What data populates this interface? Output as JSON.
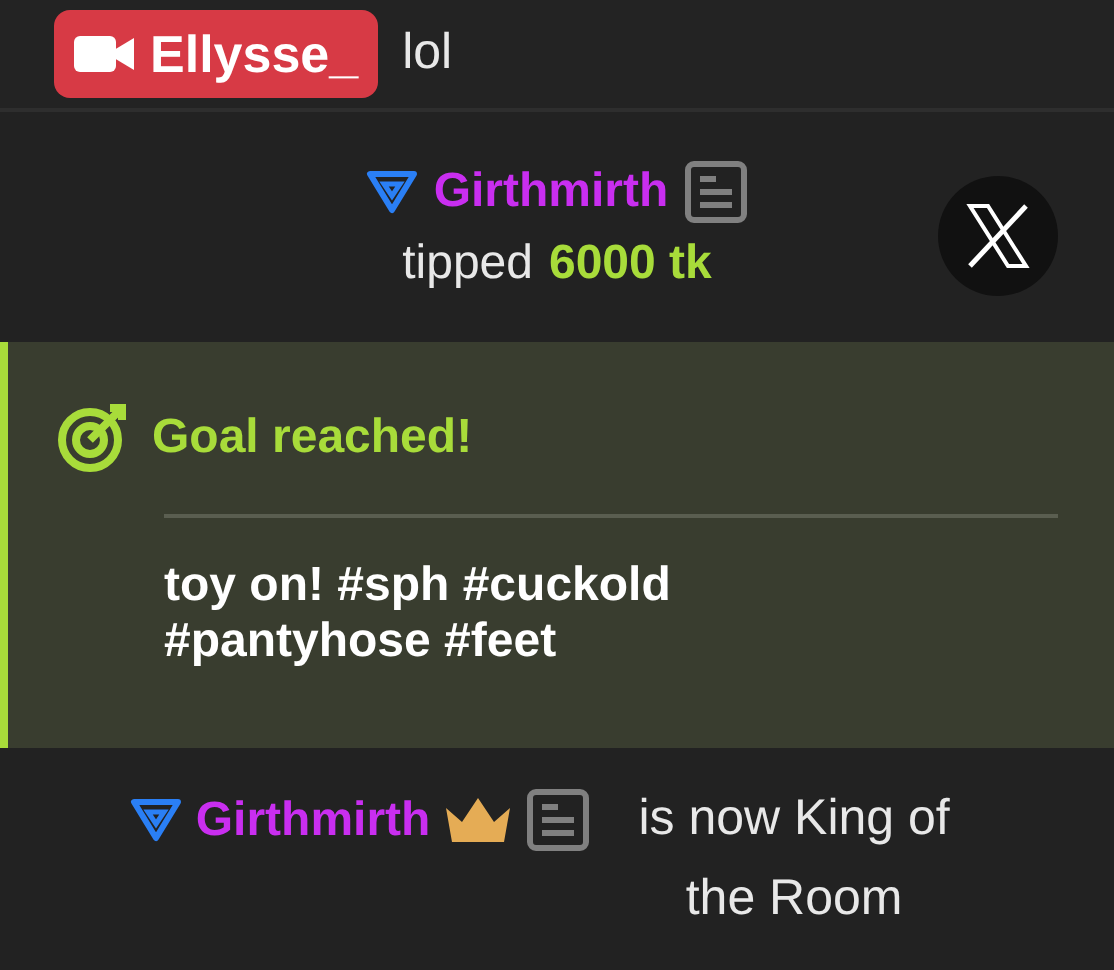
{
  "messages": [
    {
      "kind": "chat",
      "username": "Ellysse_",
      "text": "lol"
    },
    {
      "kind": "tip",
      "username": "Girthmirth",
      "action": "tipped",
      "amount": "6000 tk"
    },
    {
      "kind": "goal",
      "title": "Goal reached!",
      "text": "toy on! #sph #cuckold #pantyhose #feet"
    },
    {
      "kind": "king",
      "username": "Girthmirth",
      "text": "is now King of the Room"
    }
  ]
}
